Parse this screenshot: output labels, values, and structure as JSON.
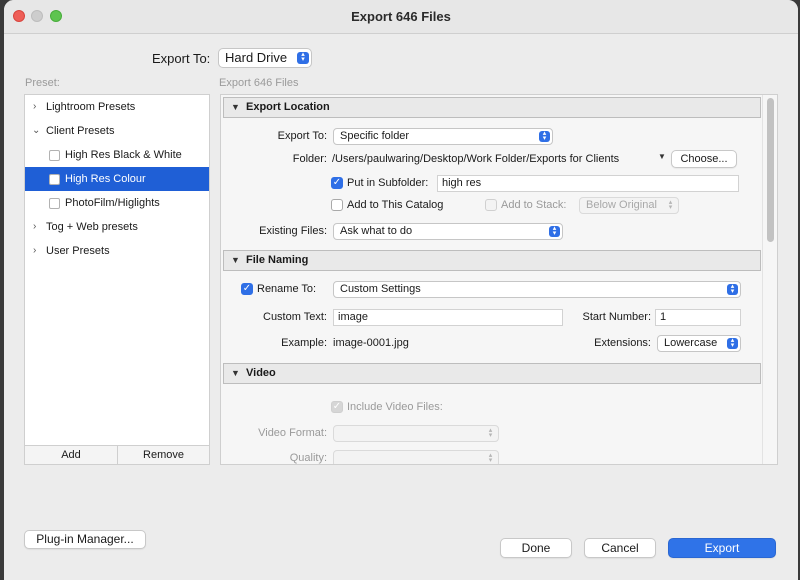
{
  "window": {
    "title": "Export 646 Files"
  },
  "export_to": {
    "label": "Export To:",
    "value": "Hard Drive"
  },
  "preset": {
    "label": "Preset:",
    "items": [
      {
        "label": "Lightroom Presets"
      },
      {
        "label": "Client Presets"
      },
      {
        "label": "High Res Black & White"
      },
      {
        "label": "High Res Colour"
      },
      {
        "label": "PhotoFilm/Higlights"
      },
      {
        "label": "Tog + Web presets"
      },
      {
        "label": "User Presets"
      }
    ],
    "add_label": "Add",
    "remove_label": "Remove"
  },
  "settings_caption": "Export 646 Files",
  "export_location": {
    "title": "Export Location",
    "export_to_label": "Export To:",
    "export_to_value": "Specific folder",
    "folder_label": "Folder:",
    "folder_path": "/Users/paulwaring/Desktop/Work Folder/Exports for Clients",
    "choose_label": "Choose...",
    "subfolder_label": "Put in Subfolder:",
    "subfolder_value": "high res",
    "add_catalog_label": "Add to This Catalog",
    "add_stack_label": "Add to Stack:",
    "stack_value": "Below Original",
    "existing_label": "Existing Files:",
    "existing_value": "Ask what to do"
  },
  "file_naming": {
    "title": "File Naming",
    "rename_label": "Rename To:",
    "rename_value": "Custom Settings",
    "custom_text_label": "Custom Text:",
    "custom_text_value": "image",
    "start_number_label": "Start Number:",
    "start_number_value": "1",
    "example_label": "Example:",
    "example_value": "image-0001.jpg",
    "extensions_label": "Extensions:",
    "extensions_value": "Lowercase"
  },
  "video": {
    "title": "Video",
    "include_label": "Include Video Files:",
    "format_label": "Video Format:",
    "quality_label": "Quality:"
  },
  "footer": {
    "plugin_label": "Plug-in Manager...",
    "done_label": "Done",
    "cancel_label": "Cancel",
    "export_label": "Export"
  },
  "colors": {
    "accent": "#2f73e8",
    "selection": "#1f5fd6"
  }
}
